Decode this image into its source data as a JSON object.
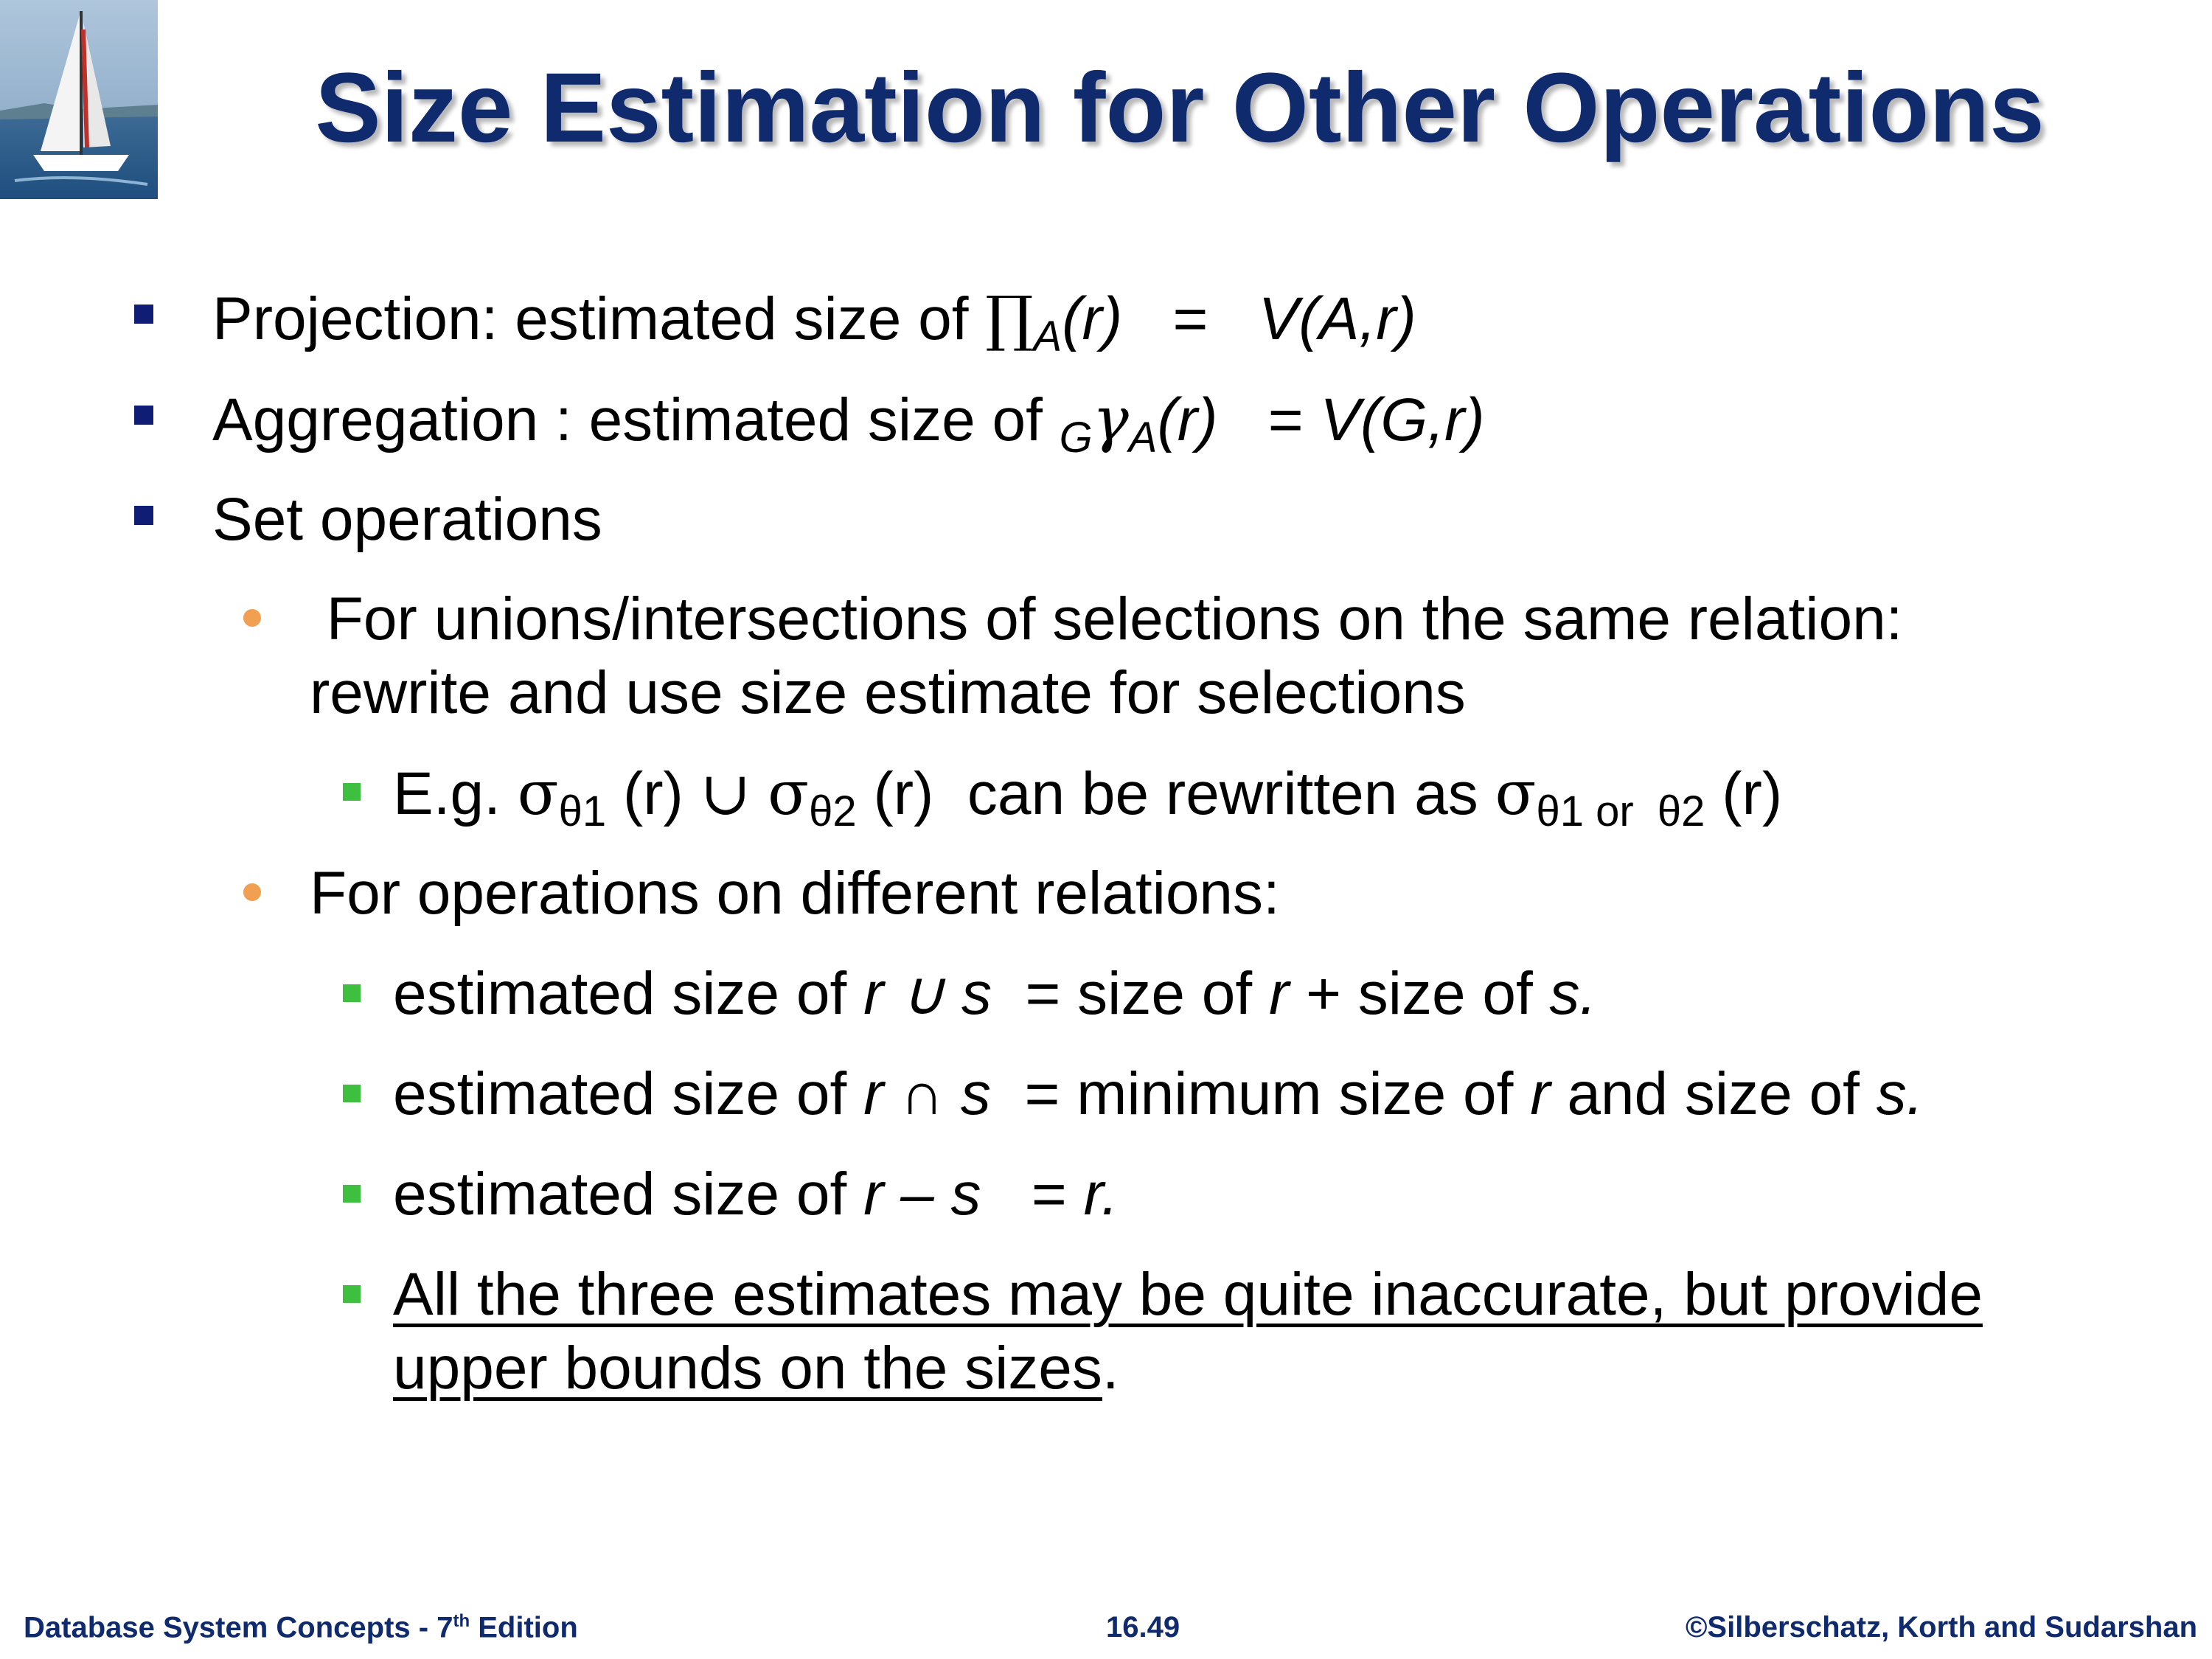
{
  "slide": {
    "title": "Size Estimation for Other Operations",
    "bullets": {
      "projection": {
        "label": "Projection:  estimated size of ",
        "op": "∏",
        "op_sub": "A",
        "arg": "(r)",
        "eq": "   =   ",
        "rhs": "V(A,r)"
      },
      "aggregation": {
        "label": "Aggregation : estimated size of ",
        "pre_sub": "G",
        "op": "γ",
        "op_sub": "A",
        "arg": "(r)",
        "eq": "   = ",
        "rhs": "V(G,r)"
      },
      "set_ops": {
        "label": "Set operations"
      },
      "unions_line1": " For unions/intersections of selections on the same relation:",
      "unions_line2": "rewrite and use size estimate for selections",
      "example": {
        "prefix": "E.g. ",
        "sigma": "σ",
        "sub1": "θ1",
        "arg1": " (r) ",
        "union": "∪",
        "sub2": "θ2",
        "arg2": " (r)",
        "middle": "  can be rewritten as ",
        "sub3": "θ1 or  θ2",
        "arg3": " (r)"
      },
      "different_relations": "For operations on different relations:",
      "union_est": {
        "prefix": "estimated size of ",
        "expr": "r ∪ s",
        "eq": "  = size of ",
        "r": "r",
        "plus": " + size of ",
        "s": "s."
      },
      "intersect_est": {
        "prefix": "estimated size of ",
        "expr": "r ∩ s",
        "eq": "  = minimum size of ",
        "r": "r",
        "and": " and size of ",
        "s": "s."
      },
      "minus_est": {
        "prefix": "estimated size of ",
        "expr": "r – s",
        "eq": "   = ",
        "r": "r."
      },
      "note_line1": "All the three estimates may be quite inaccurate, but provide",
      "note_line2_ul": "upper bounds on the sizes",
      "note_line2_end": "."
    }
  },
  "footer": {
    "left": "Database System Concepts - 7",
    "left_sup": "th",
    "left_end": " Edition",
    "center": "16.49",
    "right": "©Silberschatz, Korth and Sudarshan"
  },
  "colors": {
    "title": "#102A6E",
    "level1_bullet": "#0F1E74",
    "level2_bullet": "#F0A050",
    "level3_bullet": "#3FBF3F",
    "footer_text": "#102A6E"
  },
  "icons": [
    "sailboat-logo"
  ]
}
